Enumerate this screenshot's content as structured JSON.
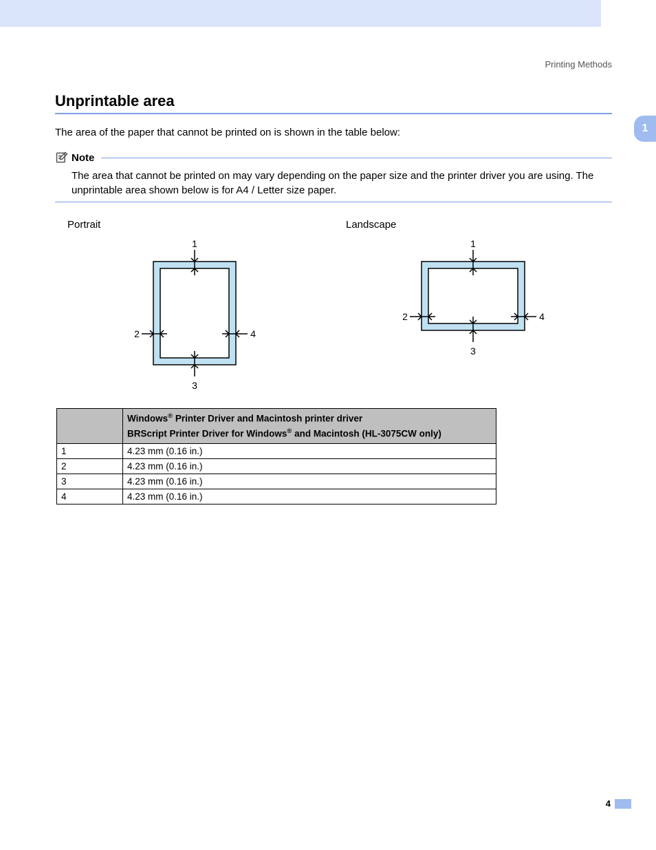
{
  "header": {
    "label": "Printing Methods"
  },
  "chapter": {
    "number": "1"
  },
  "section": {
    "title": "Unprintable area",
    "intro": "The area of the paper that cannot be printed on is shown in the table below:"
  },
  "note": {
    "label": "Note",
    "body": "The area that cannot be printed on may vary depending on the paper size and the printer driver you are using. The unprintable area shown below is for A4 / Letter size paper."
  },
  "diagrams": {
    "portrait": {
      "title": "Portrait",
      "markers": {
        "top": "1",
        "left": "2",
        "bottom": "3",
        "right": "4"
      }
    },
    "landscape": {
      "title": "Landscape",
      "markers": {
        "top": "1",
        "left": "2",
        "bottom": "3",
        "right": "4"
      }
    }
  },
  "table": {
    "header_line1_prefix": "Windows",
    "header_line1_suffix": " Printer Driver and Macintosh printer driver",
    "header_line2_prefix": "BRScript Printer Driver for Windows",
    "header_line2_suffix": " and Macintosh (HL-3075CW only)",
    "reg": "®",
    "rows": [
      {
        "n": "1",
        "v": "4.23 mm (0.16 in.)"
      },
      {
        "n": "2",
        "v": "4.23 mm (0.16 in.)"
      },
      {
        "n": "3",
        "v": "4.23 mm (0.16 in.)"
      },
      {
        "n": "4",
        "v": "4.23 mm (0.16 in.)"
      }
    ]
  },
  "footer": {
    "page": "4"
  }
}
